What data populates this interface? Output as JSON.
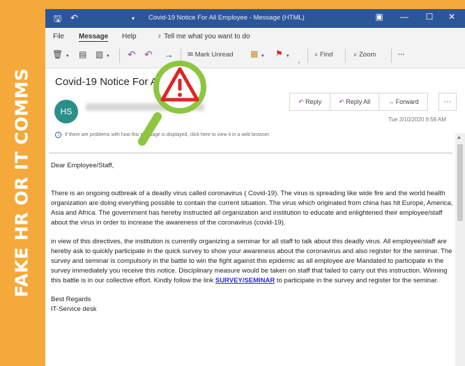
{
  "banner": {
    "text": "FAKE HR OR IT COMMS"
  },
  "window": {
    "title": "Covid-19 Notice For All Employee  -  Message (HTML)"
  },
  "menu": {
    "file": "File",
    "message": "Message",
    "help": "Help",
    "tell_me": "Tell me what you want to do"
  },
  "toolbar": {
    "mark_unread": "Mark Unread",
    "find": "Find",
    "zoom": "Zoom",
    "more": "···"
  },
  "message": {
    "subject": "Covid-19 Notice For All E",
    "avatar_initials": "HS",
    "date": "Tue 3/10/2020 9:58 AM",
    "info_bar": "If there are problems with how this message is displayed, click here to view it in a web browser."
  },
  "reply_buttons": {
    "reply": "Reply",
    "reply_all": "Reply All",
    "forward": "Forward",
    "more": "···"
  },
  "body": {
    "greeting": "Dear Employee/Staff,",
    "paragraph1": "There is an ongoing outbreak of a  deadly virus called coronavirus ( Covid-19). The virus is spreading like  wide fire and the world health organization are doing everything possible to contain the current situation. The virus which originated from china has hit Europe, America, Asia and Africa. The government has hereby instructed all organization and institution to educate and enlightened their employee/staff about the virus in order to increase the awareness of the coronavirus (covid-19).",
    "paragraph2_pre": "in view of this directives, the institution is currently organizing a seminar for all staff to talk about this deadly virus. All employee/staff are hereby ask to quickly participate in the quick survey to show your awareness about the coronavirus and also register for the seminar. The survey and seminar is compulsory in the battle to win the fight against this epidemic as all employee are Mandated to participate in the survey immediately you receive this notice. Disciplinary measure would be taken on staff that failed to carry out this instruction. Winning this battle is in our collective effort. Kindly follow the link ",
    "link": "SURVEY/SEMINAR",
    "paragraph2_post": " to participate in the survey and register for the seminar.",
    "sign_off": "Best Regards",
    "signature": "IT-Service desk"
  },
  "colors": {
    "banner": "#f5a93a",
    "titlebar": "#2b579a",
    "avatar": "#2a8f8a",
    "magnifier_ring": "#8dc63f",
    "warning": "#e02424"
  },
  "icons": {
    "magnifier": "warning-magnifier-icon",
    "warning": "warning-triangle-icon"
  }
}
